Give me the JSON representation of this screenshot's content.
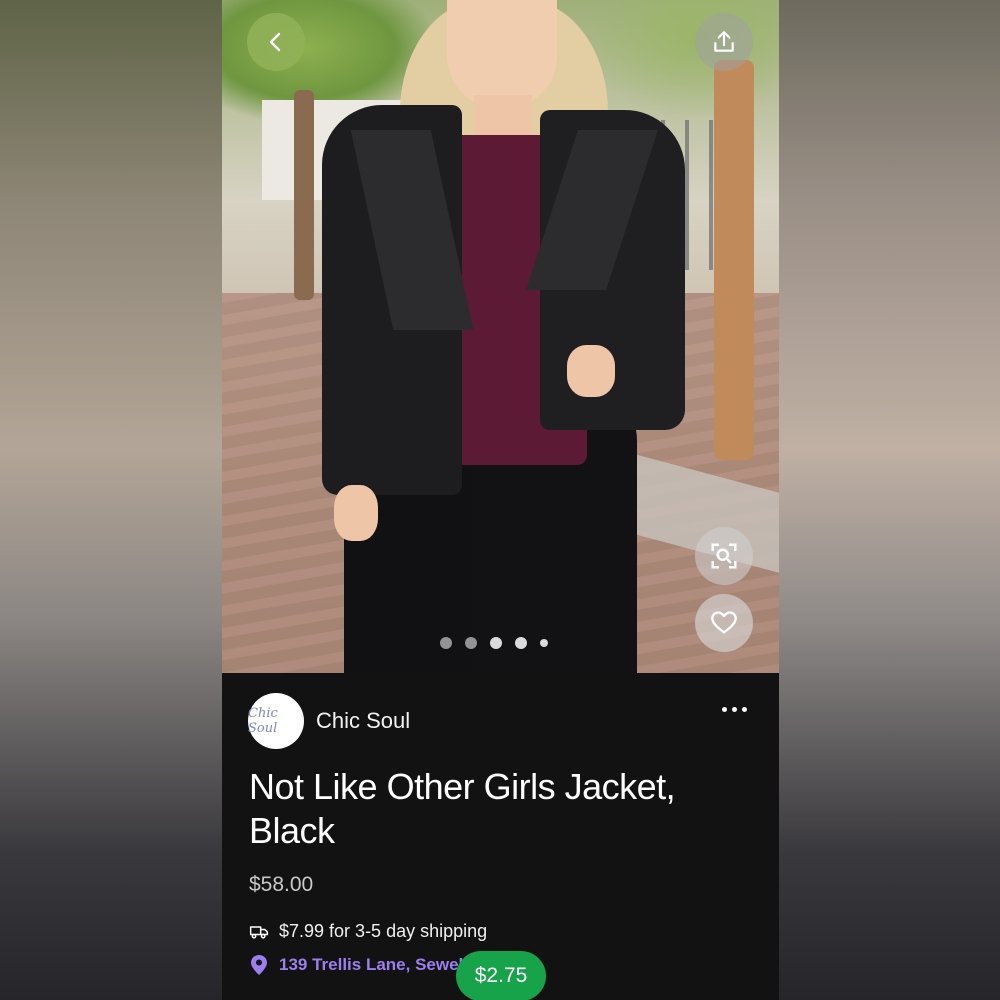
{
  "seller": {
    "name": "Chic Soul",
    "logo_text": "Chic Soul"
  },
  "product": {
    "title": "Not Like Other Girls Jacket, Black",
    "price": "$58.00"
  },
  "shipping": {
    "text": "$7.99 for 3-5 day shipping",
    "icon": "truck-icon"
  },
  "location": {
    "text": "139 Trellis Lane, Sewell",
    "icon": "location-pin-icon"
  },
  "price_badge": "$2.75",
  "carousel": {
    "total": 5,
    "active_index": 4
  },
  "colors": {
    "accent_location": "#9b7ef0",
    "badge_green": "#16a34a",
    "panel_bg": "#121212"
  },
  "icons": [
    "chevron-left-icon",
    "share-icon",
    "visual-search-icon",
    "heart-icon",
    "more-icon"
  ]
}
